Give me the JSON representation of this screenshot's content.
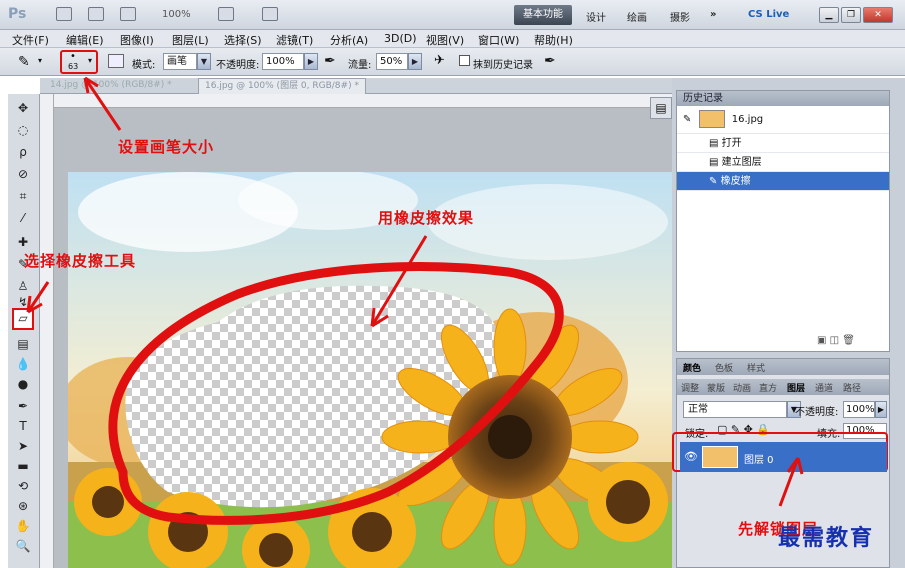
{
  "titlebar": {
    "logo": "Ps",
    "zoom": "100%",
    "workspaces": [
      "基本功能",
      "设计",
      "绘画",
      "摄影"
    ],
    "more": "»",
    "cslive": "CS Live"
  },
  "menus": [
    "文件(F)",
    "编辑(E)",
    "图像(I)",
    "图层(L)",
    "选择(S)",
    "滤镜(T)",
    "分析(A)",
    "3D(D)",
    "视图(V)",
    "窗口(W)",
    "帮助(H)"
  ],
  "options": {
    "brush_size": "63",
    "mode_label": "模式:",
    "mode_value": "画笔",
    "opacity_label": "不透明度:",
    "opacity_value": "100%",
    "flow_label": "流量:",
    "flow_value": "50%",
    "erase_history_label": "抹到历史记录"
  },
  "tabs": [
    {
      "label": "14.jpg @ 100% (RGB/8#) *"
    },
    {
      "label": "16.jpg @ 100% (图层 0, RGB/8#) *"
    }
  ],
  "history": {
    "title": "历史记录",
    "snapshot": "16.jpg",
    "items": [
      "打开",
      "建立图层",
      "橡皮擦"
    ]
  },
  "layers": {
    "tabs_top": [
      "颜色",
      "色板",
      "样式"
    ],
    "tabs_mid": [
      "调整",
      "蒙版",
      "动画",
      "直方",
      "图层",
      "通道",
      "路径"
    ],
    "blend_mode": "正常",
    "opacity_label": "不透明度:",
    "opacity_value": "100%",
    "lock_label": "锁定:",
    "fill_label": "填充:",
    "fill_value": "100%",
    "layer_name": "图层 0"
  },
  "annotations": {
    "brush_size": "设置画笔大小",
    "eraser_tool": "选择橡皮擦工具",
    "effect": "用橡皮擦效果",
    "unlock": "先解锁图层"
  },
  "watermark": "最需教育",
  "colors": {
    "accent": "#3a6fc7",
    "annotation": "#e01010",
    "watermark": "#1730b0"
  }
}
